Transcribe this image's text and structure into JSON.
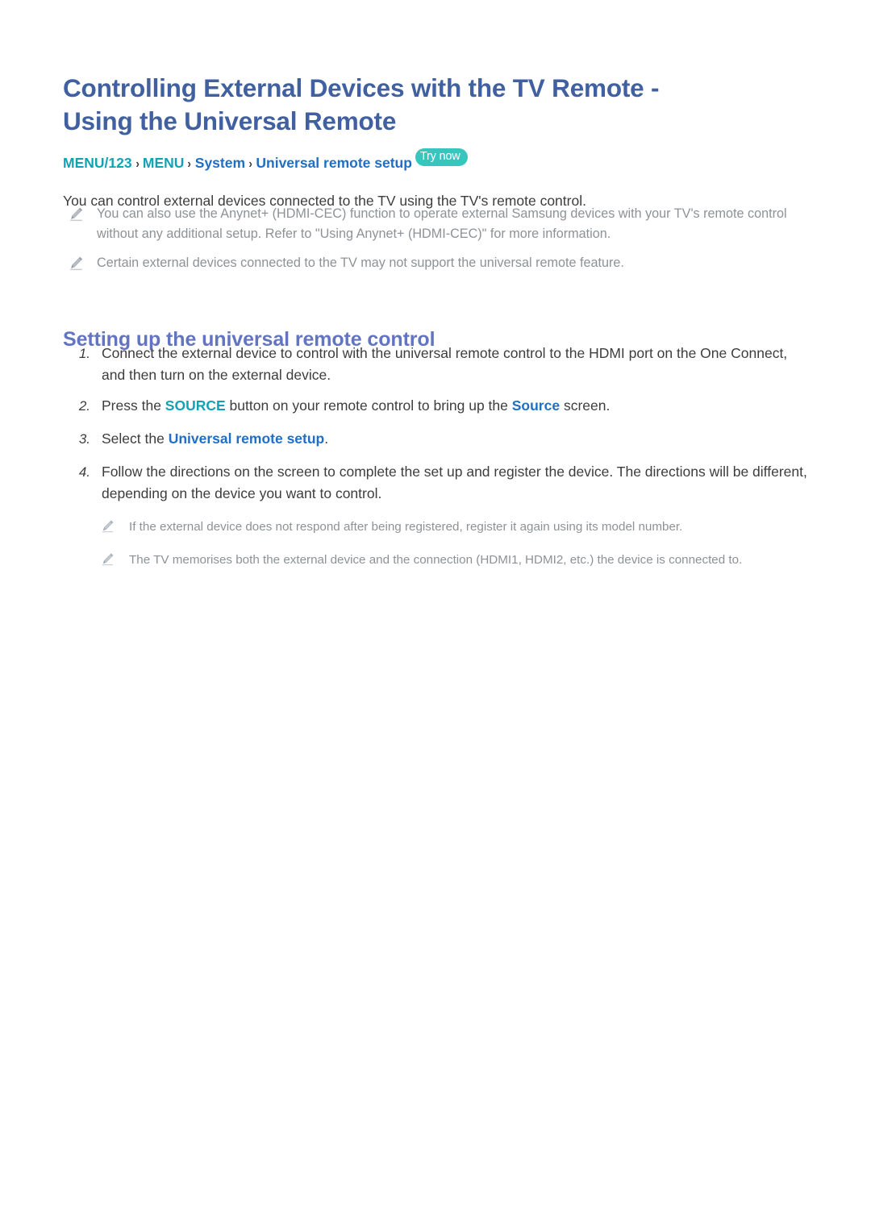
{
  "title": {
    "line1": "Controlling External Devices with the TV Remote -",
    "line2": "Using the Universal Remote"
  },
  "breadcrumb": {
    "items": [
      "MENU/123",
      "MENU",
      "System",
      "Universal remote setup"
    ],
    "separator": "›",
    "badge": "Try now"
  },
  "intro": "You can control external devices connected to the TV using the TV's remote control.",
  "top_notes": [
    {
      "icon": "pencil-icon",
      "text": "You can also use the Anynet+ (HDMI-CEC) function to operate external Samsung devices with your TV's remote control without any additional setup. Refer to \"Using Anynet+ (HDMI-CEC)\" for more information."
    },
    {
      "icon": "pencil-icon",
      "text": "Certain external devices connected to the TV may not support the universal remote feature."
    }
  ],
  "section": {
    "heading": "Setting up the universal remote control"
  },
  "steps": [
    {
      "num": "1.",
      "text_before": "Connect the external device to control with the universal remote control to the HDMI port on the One Connect, and then turn on the external device.",
      "kw1": "",
      "text_mid": "",
      "kw2": "",
      "text_after": ""
    },
    {
      "num": "2.",
      "text_before": "Press the ",
      "kw1": "SOURCE",
      "text_mid": " button on your remote control to bring up the ",
      "kw2": "Source",
      "text_after": " screen."
    },
    {
      "num": "3.",
      "text_before": "Select the ",
      "kw1": "Universal remote setup",
      "text_mid": ".",
      "kw2": "",
      "text_after": ""
    },
    {
      "num": "4.",
      "text_before": "Follow the directions on the screen to complete the set up and register the device. The directions will be different, depending on the device you want to control.",
      "kw1": "",
      "text_mid": "",
      "kw2": "",
      "text_after": ""
    }
  ],
  "sub_notes": [
    {
      "icon": "pencil-icon",
      "text": "If the external device does not respond after being registered, register it again using its model number."
    },
    {
      "icon": "pencil-icon",
      "text": "The TV memorises both the external device and the connection (HDMI1, HDMI2, etc.) the device is connected to."
    }
  ],
  "colors": {
    "title": "#41609f",
    "section_heading": "#6374c0",
    "breadcrumb_teal": "#12a2b4",
    "breadcrumb_blue": "#1f6fc4",
    "badge_bg": "#36c6bd",
    "body_text": "#3d3d3d",
    "note_text": "#8d9296"
  }
}
